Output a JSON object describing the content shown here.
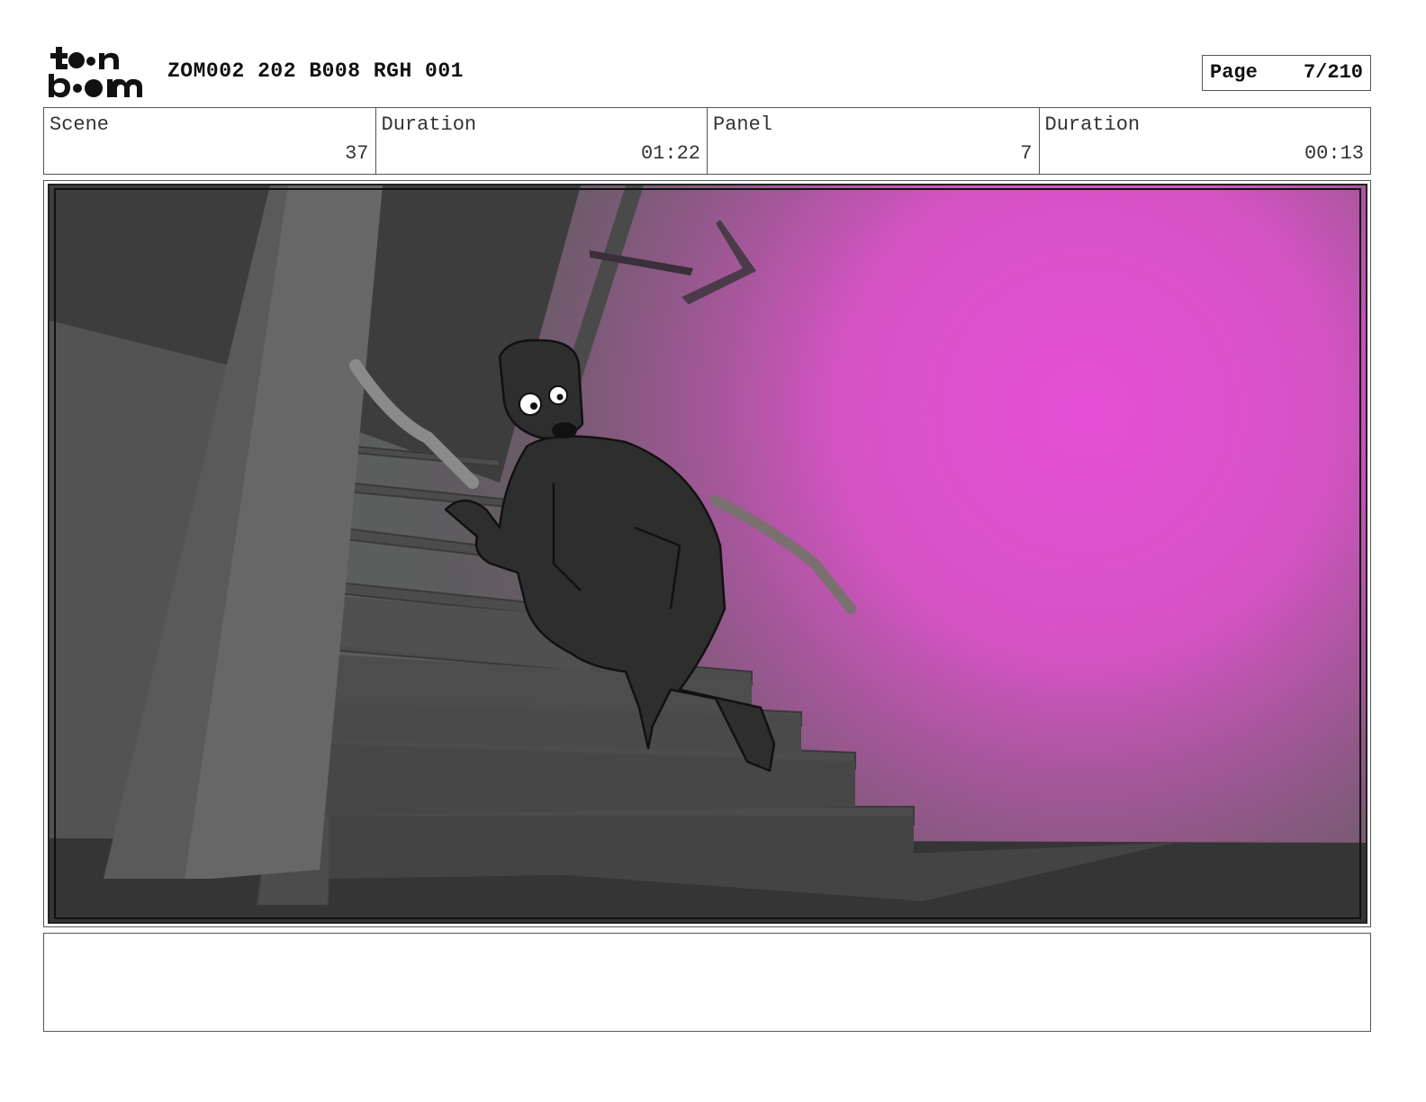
{
  "header": {
    "logo_text": "toon boom",
    "project_title": "ZOM002 202 B008 RGH 001",
    "page_label": "Page",
    "page_value": "7/210"
  },
  "info": {
    "scene_label": "Scene",
    "scene_value": "37",
    "scene_duration_label": "Duration",
    "scene_duration_value": "01:22",
    "panel_label": "Panel",
    "panel_value": "7",
    "panel_duration_label": "Duration",
    "panel_duration_value": "00:13"
  },
  "panel": {
    "image": "storyboard-sketch-figure-crawling-up-stairs-looking-back",
    "accent_color": "#e64fd6"
  },
  "notes": {
    "text": ""
  }
}
